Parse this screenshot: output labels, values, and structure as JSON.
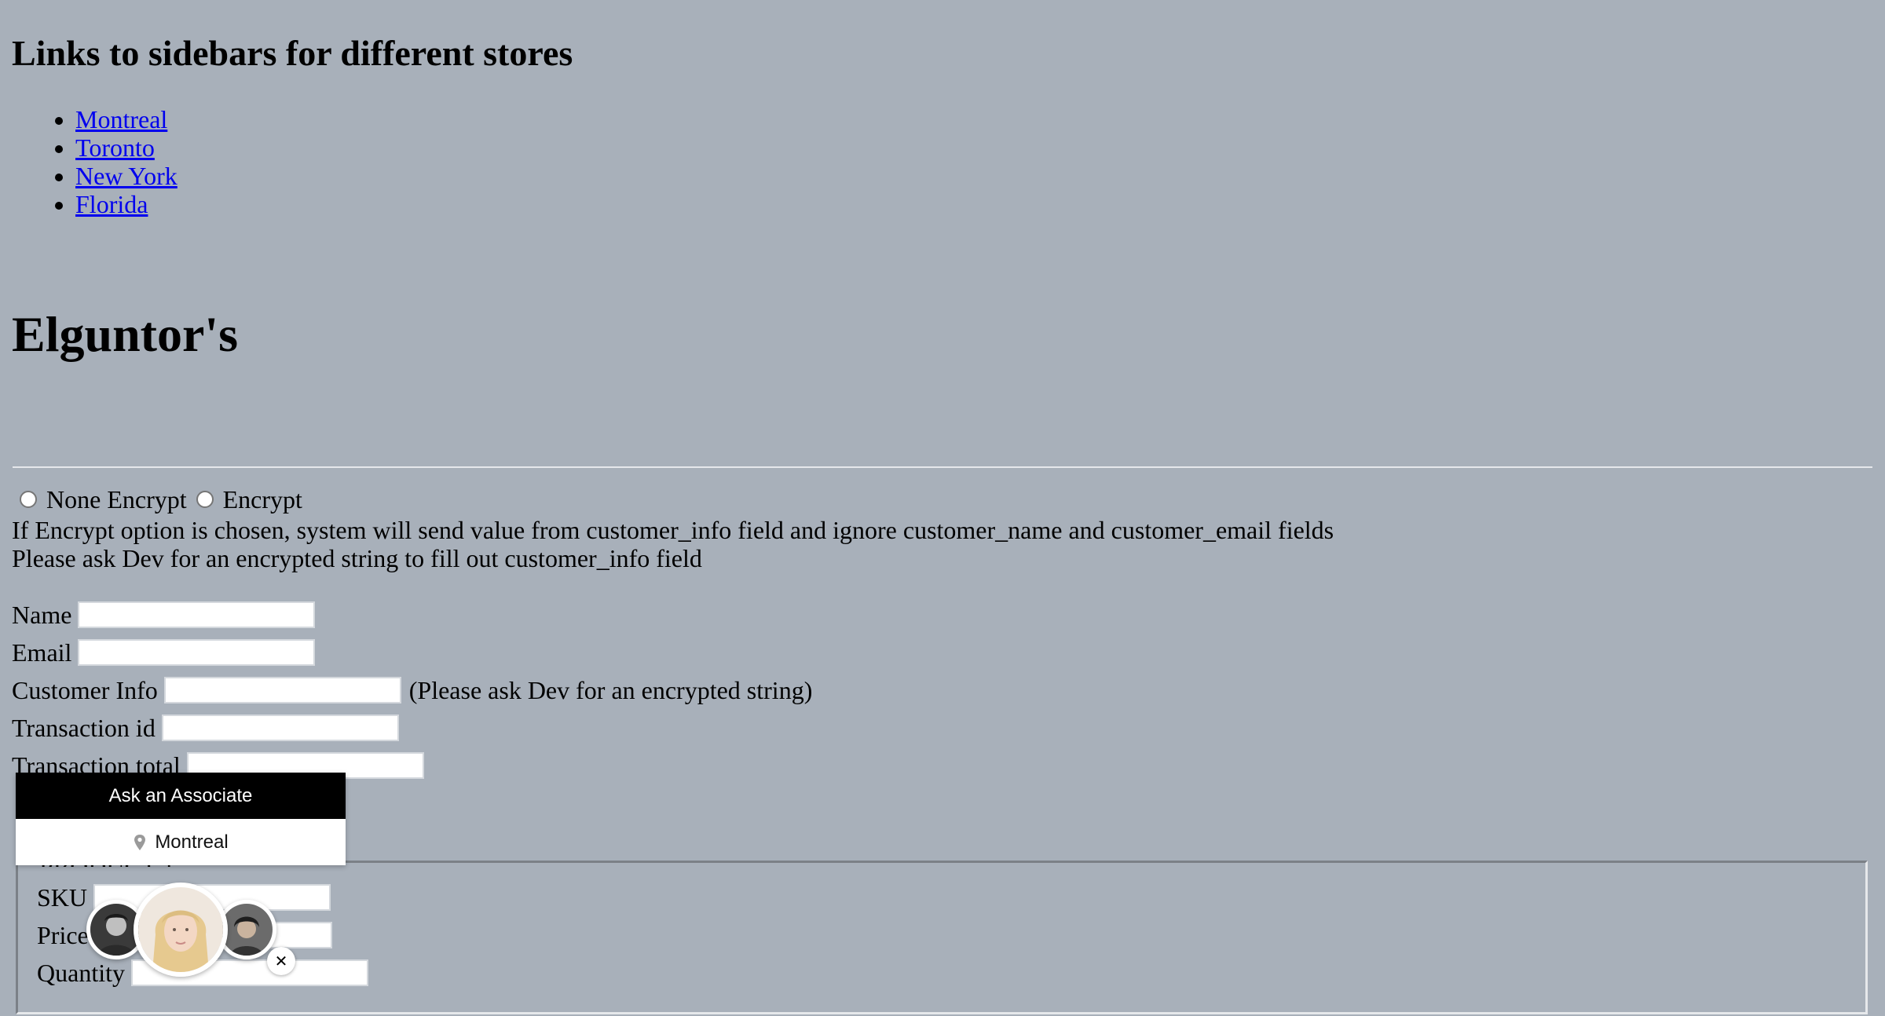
{
  "links_heading": "Links to sidebars for different stores",
  "stores": [
    "Montreal",
    "Toronto",
    "New York",
    "Florida"
  ],
  "brand": "Elguntor's",
  "encryption": {
    "option_none": "None Encrypt",
    "option_encrypt": "Encrypt",
    "note_1": "If Encrypt option is chosen, system will send value from customer_info field and ignore customer_name and customer_email fields",
    "note_2": "Please ask Dev for an encrypted string to fill out customer_info field"
  },
  "form": {
    "name_label": "Name",
    "email_label": "Email",
    "customer_info_label": "Customer Info",
    "customer_info_hint": "(Please ask Dev for an encrypted string)",
    "transaction_id_label": "Transaction id",
    "transaction_total_label": "Transaction total"
  },
  "product": {
    "legend": "PRODUCT 1",
    "sku_label": "SKU",
    "price_label": "Price",
    "quantity_label": "Quantity"
  },
  "widget": {
    "title": "Ask an Associate",
    "location": "Montreal",
    "close_symbol": "✕"
  },
  "icons": [
    "pin-icon",
    "close-icon"
  ]
}
